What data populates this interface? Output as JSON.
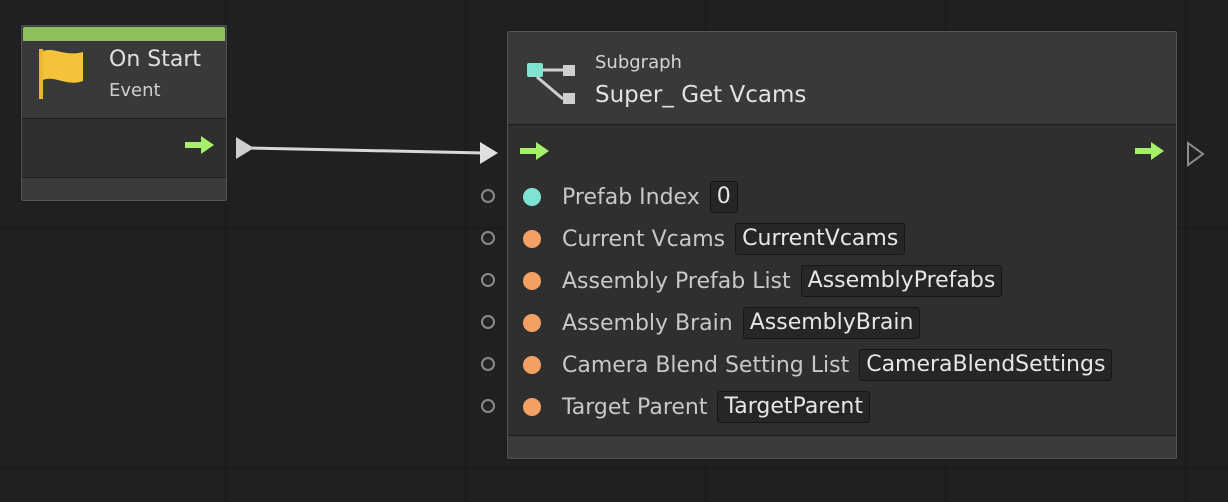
{
  "on_start_node": {
    "title": "On Start",
    "subtitle": "Event",
    "accent_color": "#8dbf5a",
    "icon": "yellow-flag-icon"
  },
  "subgraph_node": {
    "kind_label": "Subgraph",
    "name": "Super_ Get Vcams",
    "icon": "subgraph-icon",
    "ports": [
      {
        "label": "Prefab Index",
        "value": "0",
        "color": "#7fe3d1"
      },
      {
        "label": "Current Vcams",
        "value": "CurrentVcams",
        "color": "#f2a063"
      },
      {
        "label": "Assembly Prefab List",
        "value": "AssemblyPrefabs",
        "color": "#f2a063"
      },
      {
        "label": "Assembly Brain",
        "value": "AssemblyBrain",
        "color": "#f2a063"
      },
      {
        "label": "Camera Blend Setting List",
        "value": "CameraBlendSettings",
        "color": "#f2a063"
      },
      {
        "label": "Target Parent",
        "value": "TargetParent",
        "color": "#f2a063"
      }
    ]
  },
  "colors": {
    "control_arrow": "#a6f06a",
    "background": "#202020"
  }
}
